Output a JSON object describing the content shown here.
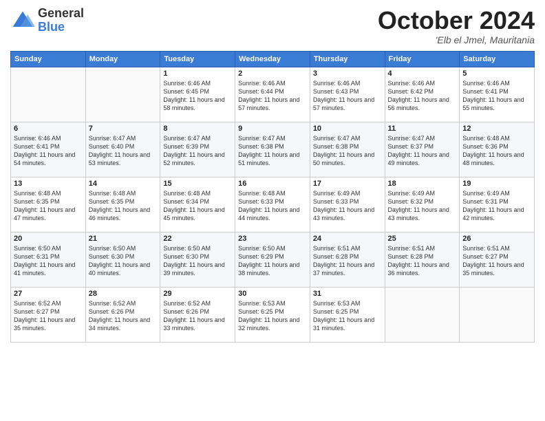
{
  "header": {
    "logo_general": "General",
    "logo_blue": "Blue",
    "month": "October 2024",
    "location": "'Elb el Jmel, Mauritania"
  },
  "days_of_week": [
    "Sunday",
    "Monday",
    "Tuesday",
    "Wednesday",
    "Thursday",
    "Friday",
    "Saturday"
  ],
  "weeks": [
    [
      {
        "day": "",
        "sunrise": "",
        "sunset": "",
        "daylight": ""
      },
      {
        "day": "",
        "sunrise": "",
        "sunset": "",
        "daylight": ""
      },
      {
        "day": "1",
        "sunrise": "Sunrise: 6:46 AM",
        "sunset": "Sunset: 6:45 PM",
        "daylight": "Daylight: 11 hours and 58 minutes."
      },
      {
        "day": "2",
        "sunrise": "Sunrise: 6:46 AM",
        "sunset": "Sunset: 6:44 PM",
        "daylight": "Daylight: 11 hours and 57 minutes."
      },
      {
        "day": "3",
        "sunrise": "Sunrise: 6:46 AM",
        "sunset": "Sunset: 6:43 PM",
        "daylight": "Daylight: 11 hours and 57 minutes."
      },
      {
        "day": "4",
        "sunrise": "Sunrise: 6:46 AM",
        "sunset": "Sunset: 6:42 PM",
        "daylight": "Daylight: 11 hours and 56 minutes."
      },
      {
        "day": "5",
        "sunrise": "Sunrise: 6:46 AM",
        "sunset": "Sunset: 6:41 PM",
        "daylight": "Daylight: 11 hours and 55 minutes."
      }
    ],
    [
      {
        "day": "6",
        "sunrise": "Sunrise: 6:46 AM",
        "sunset": "Sunset: 6:41 PM",
        "daylight": "Daylight: 11 hours and 54 minutes."
      },
      {
        "day": "7",
        "sunrise": "Sunrise: 6:47 AM",
        "sunset": "Sunset: 6:40 PM",
        "daylight": "Daylight: 11 hours and 53 minutes."
      },
      {
        "day": "8",
        "sunrise": "Sunrise: 6:47 AM",
        "sunset": "Sunset: 6:39 PM",
        "daylight": "Daylight: 11 hours and 52 minutes."
      },
      {
        "day": "9",
        "sunrise": "Sunrise: 6:47 AM",
        "sunset": "Sunset: 6:38 PM",
        "daylight": "Daylight: 11 hours and 51 minutes."
      },
      {
        "day": "10",
        "sunrise": "Sunrise: 6:47 AM",
        "sunset": "Sunset: 6:38 PM",
        "daylight": "Daylight: 11 hours and 50 minutes."
      },
      {
        "day": "11",
        "sunrise": "Sunrise: 6:47 AM",
        "sunset": "Sunset: 6:37 PM",
        "daylight": "Daylight: 11 hours and 49 minutes."
      },
      {
        "day": "12",
        "sunrise": "Sunrise: 6:48 AM",
        "sunset": "Sunset: 6:36 PM",
        "daylight": "Daylight: 11 hours and 48 minutes."
      }
    ],
    [
      {
        "day": "13",
        "sunrise": "Sunrise: 6:48 AM",
        "sunset": "Sunset: 6:35 PM",
        "daylight": "Daylight: 11 hours and 47 minutes."
      },
      {
        "day": "14",
        "sunrise": "Sunrise: 6:48 AM",
        "sunset": "Sunset: 6:35 PM",
        "daylight": "Daylight: 11 hours and 46 minutes."
      },
      {
        "day": "15",
        "sunrise": "Sunrise: 6:48 AM",
        "sunset": "Sunset: 6:34 PM",
        "daylight": "Daylight: 11 hours and 45 minutes."
      },
      {
        "day": "16",
        "sunrise": "Sunrise: 6:48 AM",
        "sunset": "Sunset: 6:33 PM",
        "daylight": "Daylight: 11 hours and 44 minutes."
      },
      {
        "day": "17",
        "sunrise": "Sunrise: 6:49 AM",
        "sunset": "Sunset: 6:33 PM",
        "daylight": "Daylight: 11 hours and 43 minutes."
      },
      {
        "day": "18",
        "sunrise": "Sunrise: 6:49 AM",
        "sunset": "Sunset: 6:32 PM",
        "daylight": "Daylight: 11 hours and 43 minutes."
      },
      {
        "day": "19",
        "sunrise": "Sunrise: 6:49 AM",
        "sunset": "Sunset: 6:31 PM",
        "daylight": "Daylight: 11 hours and 42 minutes."
      }
    ],
    [
      {
        "day": "20",
        "sunrise": "Sunrise: 6:50 AM",
        "sunset": "Sunset: 6:31 PM",
        "daylight": "Daylight: 11 hours and 41 minutes."
      },
      {
        "day": "21",
        "sunrise": "Sunrise: 6:50 AM",
        "sunset": "Sunset: 6:30 PM",
        "daylight": "Daylight: 11 hours and 40 minutes."
      },
      {
        "day": "22",
        "sunrise": "Sunrise: 6:50 AM",
        "sunset": "Sunset: 6:30 PM",
        "daylight": "Daylight: 11 hours and 39 minutes."
      },
      {
        "day": "23",
        "sunrise": "Sunrise: 6:50 AM",
        "sunset": "Sunset: 6:29 PM",
        "daylight": "Daylight: 11 hours and 38 minutes."
      },
      {
        "day": "24",
        "sunrise": "Sunrise: 6:51 AM",
        "sunset": "Sunset: 6:28 PM",
        "daylight": "Daylight: 11 hours and 37 minutes."
      },
      {
        "day": "25",
        "sunrise": "Sunrise: 6:51 AM",
        "sunset": "Sunset: 6:28 PM",
        "daylight": "Daylight: 11 hours and 36 minutes."
      },
      {
        "day": "26",
        "sunrise": "Sunrise: 6:51 AM",
        "sunset": "Sunset: 6:27 PM",
        "daylight": "Daylight: 11 hours and 35 minutes."
      }
    ],
    [
      {
        "day": "27",
        "sunrise": "Sunrise: 6:52 AM",
        "sunset": "Sunset: 6:27 PM",
        "daylight": "Daylight: 11 hours and 35 minutes."
      },
      {
        "day": "28",
        "sunrise": "Sunrise: 6:52 AM",
        "sunset": "Sunset: 6:26 PM",
        "daylight": "Daylight: 11 hours and 34 minutes."
      },
      {
        "day": "29",
        "sunrise": "Sunrise: 6:52 AM",
        "sunset": "Sunset: 6:26 PM",
        "daylight": "Daylight: 11 hours and 33 minutes."
      },
      {
        "day": "30",
        "sunrise": "Sunrise: 6:53 AM",
        "sunset": "Sunset: 6:25 PM",
        "daylight": "Daylight: 11 hours and 32 minutes."
      },
      {
        "day": "31",
        "sunrise": "Sunrise: 6:53 AM",
        "sunset": "Sunset: 6:25 PM",
        "daylight": "Daylight: 11 hours and 31 minutes."
      },
      {
        "day": "",
        "sunrise": "",
        "sunset": "",
        "daylight": ""
      },
      {
        "day": "",
        "sunrise": "",
        "sunset": "",
        "daylight": ""
      }
    ]
  ]
}
